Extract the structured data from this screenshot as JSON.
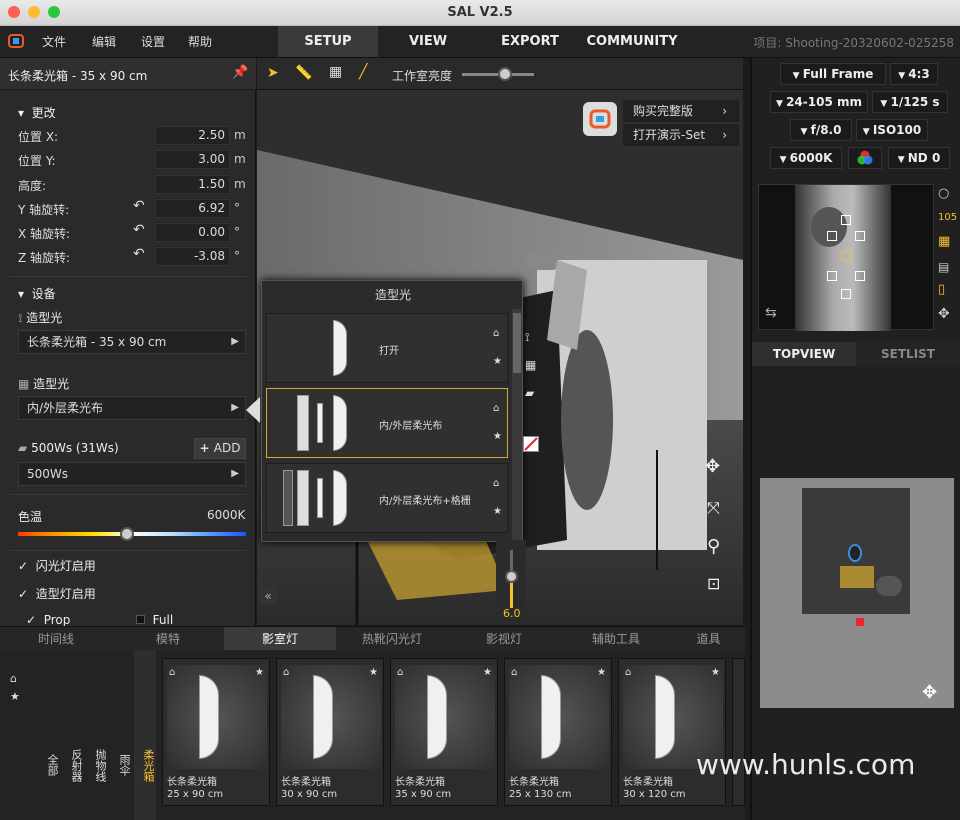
{
  "window": {
    "title": "SAL V2.5"
  },
  "menu": {
    "file": "文件",
    "edit": "编辑",
    "settings": "设置",
    "help": "帮助"
  },
  "nav": {
    "setup": "SETUP",
    "view": "VIEW",
    "export": "EXPORT",
    "community": "COMMUNITY"
  },
  "project": "项目: Shooting-20320602-025258",
  "left": {
    "title": "长条柔光箱 - 35 x 90 cm",
    "section_change": "更改",
    "pos_x_label": "位置 X:",
    "pos_x": "2.50",
    "pos_x_unit": "m",
    "pos_y_label": "位置 Y:",
    "pos_y": "3.00",
    "pos_y_unit": "m",
    "height_label": "高度:",
    "height": "1.50",
    "height_unit": "m",
    "rot_y_label": "Y 轴旋转:",
    "rot_y": "6.92",
    "rot_y_unit": "°",
    "rot_x_label": "X 轴旋转:",
    "rot_x": "0.00",
    "rot_x_unit": "°",
    "rot_z_label": "Z 轴旋转:",
    "rot_z": "-3.08",
    "rot_z_unit": "°",
    "section_device": "设备",
    "modifier_label": "造型光",
    "modifier_value": "长条柔光箱 - 35 x 90 cm",
    "modifier2_label": "造型光",
    "modifier2_value": "内/外层柔光布",
    "power_label": "500Ws (31Ws)",
    "add_label": "ADD",
    "power_value": "500Ws",
    "color_temp_label": "色温",
    "color_temp_value": "6000K",
    "color_temp_level": 0.48,
    "flash_enable": "闪光灯启用",
    "model_enable": "造型灯启用",
    "prop": "Prop",
    "full": "Full"
  },
  "viewport_toolbar": {
    "brightness_label": "工作室亮度",
    "brightness_level": 0.6
  },
  "viewport": {
    "buy_full": "购买完整版",
    "open_demo": "打开演示-Set"
  },
  "popup": {
    "title": "造型光",
    "items": [
      {
        "label": "打开"
      },
      {
        "label": "内/外层柔光布"
      },
      {
        "label": "内/外层柔光布+格栅"
      }
    ],
    "slider_value": "6.0",
    "slider_level": 0.55
  },
  "right": {
    "sensor": "Full Frame",
    "ratio": "4:3",
    "lens": "24-105 mm",
    "shutter": "1/125 s",
    "aperture": "f/8.0",
    "iso": "ISO100",
    "wb": "6000K",
    "nd": "ND 0",
    "side_label": "105",
    "tab_topview": "TOPVIEW",
    "tab_setlist": "SETLIST"
  },
  "bottom": {
    "tabs": [
      "时间线",
      "模特",
      "影室灯",
      "热靴闪光灯",
      "影视灯",
      "辅助工具",
      "道具"
    ],
    "categories": [
      "全部",
      "反射器",
      "抛物线",
      "雨伞",
      "柔光箱"
    ],
    "cards": [
      {
        "name": "长条柔光箱",
        "size": "25 x 90 cm"
      },
      {
        "name": "长条柔光箱",
        "size": "30 x 90 cm"
      },
      {
        "name": "长条柔光箱",
        "size": "35 x 90 cm"
      },
      {
        "name": "长条柔光箱",
        "size": "25 x 130 cm"
      },
      {
        "name": "长条柔光箱",
        "size": "30 x 120 cm"
      }
    ]
  },
  "watermark": "www.hunls.com"
}
